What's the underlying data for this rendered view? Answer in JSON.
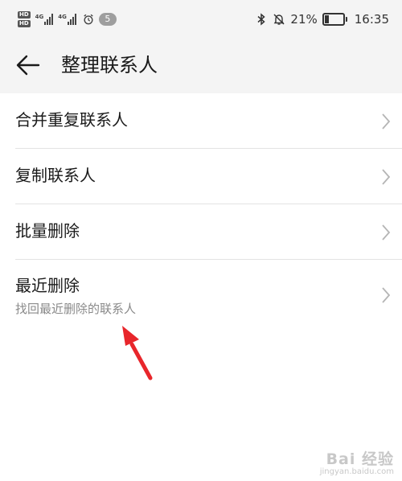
{
  "status_bar": {
    "hd_badges": [
      "HD",
      "HD"
    ],
    "network_labels": [
      "4G",
      "4G"
    ],
    "notification_count": "5",
    "battery_percent": "21%",
    "battery_level": 0.21,
    "time": "16:35",
    "icons": [
      "bluetooth-icon",
      "mute-bell-icon",
      "battery-icon",
      "alarm-icon",
      "signal-icon"
    ]
  },
  "app_bar": {
    "back_icon": "back-arrow-icon",
    "title": "整理联系人"
  },
  "menu": {
    "items": [
      {
        "label": "合并重复联系人"
      },
      {
        "label": "复制联系人"
      },
      {
        "label": "批量删除"
      },
      {
        "label": "最近删除",
        "subtitle": "找回最近删除的联系人"
      }
    ]
  },
  "annotation": {
    "arrow_color": "#e8262b"
  },
  "watermark": {
    "logo": "Bai 经验",
    "url": "jingyan.baidu.com"
  },
  "colors": {
    "header_bg": "#f4f4f4",
    "divider": "#e3e3e3",
    "subtitle": "#8a8a8a",
    "chevron": "#b5b5b5"
  }
}
